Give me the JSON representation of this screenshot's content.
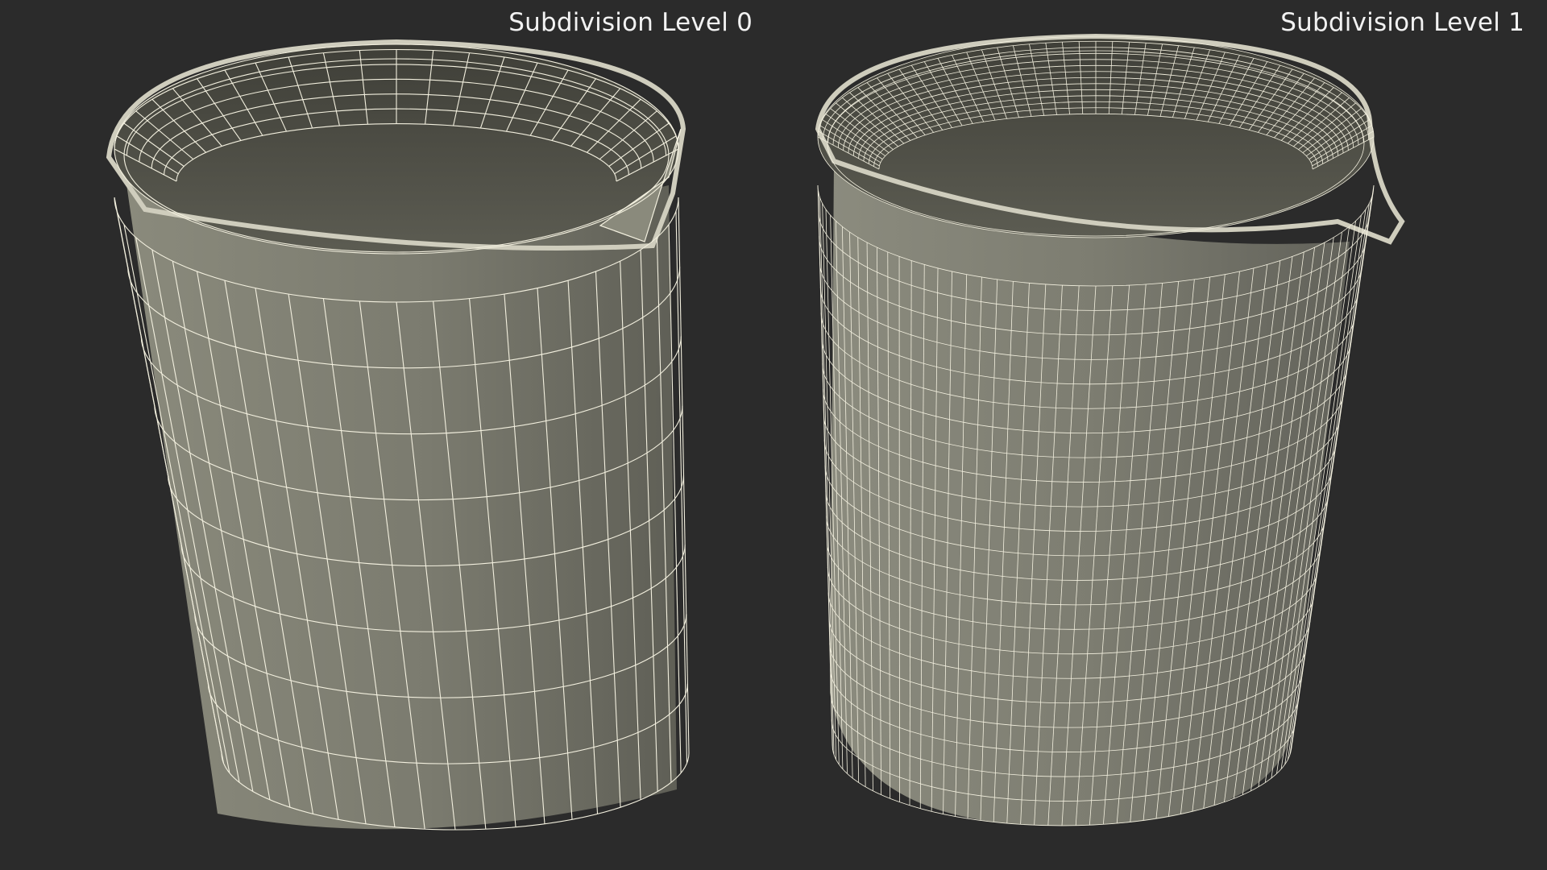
{
  "panels": [
    {
      "label": "Subdivision Level 0",
      "subdivision_level": 0
    },
    {
      "label": "Subdivision Level 1",
      "subdivision_level": 1
    }
  ],
  "colors": {
    "background": "#2b2b2b",
    "surface_light": "#8a8a7c",
    "surface_dark": "#5e5e55",
    "inner_dark": "#4a4a42",
    "wire": "#f3f0df",
    "label": "#f2f2f2"
  }
}
